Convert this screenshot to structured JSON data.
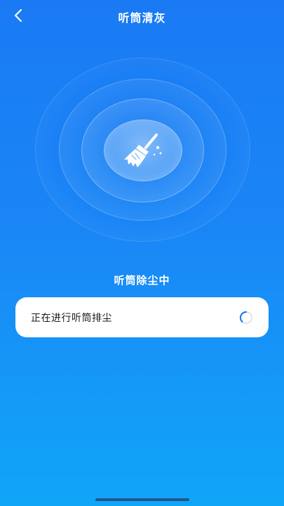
{
  "header": {
    "title": "听筒清灰",
    "back_icon": "chevron-left-icon"
  },
  "ripple": {
    "icon": "broom-icon",
    "icon_color": "#ffffff"
  },
  "status": {
    "heading": "听筒除尘中",
    "task_label": "正在进行听筒排尘",
    "indicator_icon": "loading-spinner-icon",
    "spinner_color": "#1a7af4"
  },
  "colors": {
    "background_top": "#1a7af4",
    "background_bottom": "#10a6f8",
    "card": "#ffffff"
  }
}
